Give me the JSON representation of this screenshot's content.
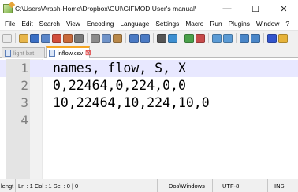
{
  "window": {
    "title": "C:\\Users\\Arash-Home\\Dropbox\\GUI\\GIFMOD User's manual\\Examples\\AS...",
    "minimize_glyph": "—",
    "maximize_glyph": "☐",
    "close_glyph": "✕"
  },
  "menu": [
    "File",
    "Edit",
    "Search",
    "View",
    "Encoding",
    "Language",
    "Settings",
    "Macro",
    "Run",
    "Plugins",
    "Window",
    "?"
  ],
  "toolbar_icons": [
    {
      "name": "new-file-icon",
      "color": "#eaeaea"
    },
    {
      "name": "open-file-icon",
      "color": "#e8b64a"
    },
    {
      "name": "save-icon",
      "color": "#3b6fc4"
    },
    {
      "name": "save-all-icon",
      "color": "#5a86c9"
    },
    {
      "name": "close-icon",
      "color": "#d14d3b"
    },
    {
      "name": "close-all-icon",
      "color": "#c96a3b"
    },
    {
      "name": "print-icon",
      "color": "#7a7a7a"
    },
    {
      "name": "cut-icon",
      "color": "#8c8c8c"
    },
    {
      "name": "copy-icon",
      "color": "#6f93c8"
    },
    {
      "name": "paste-icon",
      "color": "#b9894a"
    },
    {
      "name": "undo-icon",
      "color": "#4a7ac4"
    },
    {
      "name": "redo-icon",
      "color": "#4a7ac4"
    },
    {
      "name": "find-icon",
      "color": "#555555"
    },
    {
      "name": "replace-icon",
      "color": "#3d8fd1"
    },
    {
      "name": "zoom-in-icon",
      "color": "#4aa04a"
    },
    {
      "name": "zoom-out-icon",
      "color": "#c74a4a"
    },
    {
      "name": "sync-v-icon",
      "color": "#5b9bd5"
    },
    {
      "name": "sync-h-icon",
      "color": "#5b9bd5"
    },
    {
      "name": "word-wrap-icon",
      "color": "#4a86c8"
    },
    {
      "name": "show-all-chars-icon",
      "color": "#4a86c8"
    },
    {
      "name": "indent-guide-icon",
      "color": "#3355cc"
    },
    {
      "name": "doc-map-icon",
      "color": "#e6b33a"
    }
  ],
  "tabs": [
    {
      "label": "light bat",
      "active": false
    },
    {
      "label": "inflow.csv",
      "active": true,
      "close": "☒"
    }
  ],
  "editor": {
    "lines": [
      {
        "number": "1",
        "text": "names, flow, S, X"
      },
      {
        "number": "2",
        "text": "0,22464,0,224,0,0"
      },
      {
        "number": "3",
        "text": "10,22464,10,224,10,0"
      },
      {
        "number": "4",
        "text": ""
      }
    ]
  },
  "status": {
    "length": "lengt",
    "position": "Ln : 1   Col : 1   Sel : 0 | 0",
    "eol": "Dos\\Windows",
    "encoding": "UTF-8",
    "mode": "INS"
  }
}
